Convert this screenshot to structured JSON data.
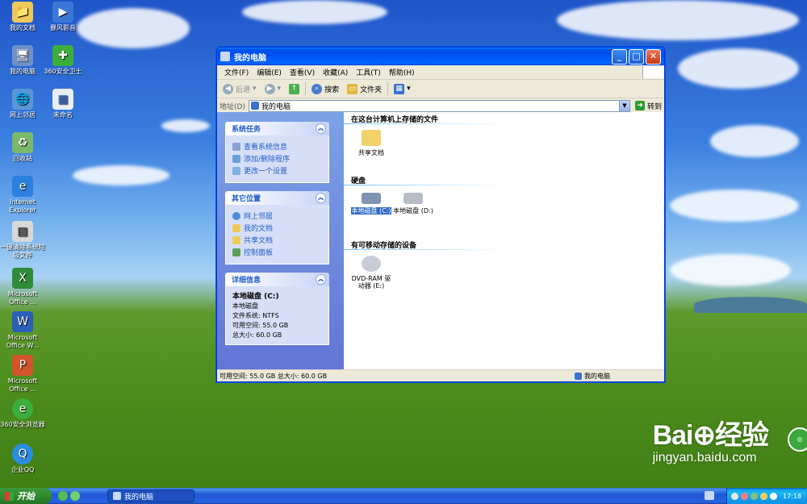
{
  "desktop": {
    "icons": [
      {
        "label": "我的文档"
      },
      {
        "label": "暴风影音"
      },
      {
        "label": "我的电脑"
      },
      {
        "label": "360安全卫士"
      },
      {
        "label": "网上邻居"
      },
      {
        "label": "未命名"
      },
      {
        "label": "回收站"
      },
      {
        "label": "Internet Explorer"
      },
      {
        "label": "一键清除系统垃圾文件"
      },
      {
        "label": "Microsoft Office ..."
      },
      {
        "label": "Microsoft Office W..."
      },
      {
        "label": "Microsoft Office ..."
      },
      {
        "label": "360安全浏览器"
      },
      {
        "label": "企业QQ"
      }
    ]
  },
  "window": {
    "title": "我的电脑",
    "buttons": {
      "minimize": "_",
      "maximize": "□",
      "close": "✕"
    },
    "menu": [
      "文件(F)",
      "编辑(E)",
      "查看(V)",
      "收藏(A)",
      "工具(T)",
      "帮助(H)"
    ],
    "toolbar": {
      "back": "后退",
      "search": "搜索",
      "folders": "文件夹"
    },
    "address": {
      "label": "地址(D)",
      "value": "我的电脑",
      "go": "转到"
    },
    "left": {
      "system_tasks": {
        "title": "系统任务",
        "links": [
          "查看系统信息",
          "添加/删除程序",
          "更改一个设置"
        ]
      },
      "other_places": {
        "title": "其它位置",
        "links": [
          "网上邻居",
          "我的文档",
          "共享文档",
          "控制面板"
        ]
      },
      "details": {
        "title": "详细信息",
        "name": "本地磁盘 (C:)",
        "type": "本地磁盘",
        "fs": "文件系统: NTFS",
        "free": "可用空间: 55.0 GB",
        "total": "总大小: 60.0 GB"
      }
    },
    "right": {
      "group1": "在这台计算机上存储的文件",
      "shared_docs": "共享文档",
      "group2": "硬盘",
      "disk_c": "本地磁盘 (C:)",
      "disk_d": "本地磁盘 (D:)",
      "group3": "有可移动存储的设备",
      "dvd": "DVD-RAM 驱动器 (E:)"
    },
    "status": {
      "left": "可用空间: 55.0 GB 总大小: 60.0 GB",
      "right": "我的电脑"
    }
  },
  "taskbar": {
    "start": "开始",
    "task": "我的电脑",
    "clock": "17:18"
  },
  "watermark": {
    "brand": "Bai⊕经验",
    "url": "jingyan.baidu.com"
  }
}
